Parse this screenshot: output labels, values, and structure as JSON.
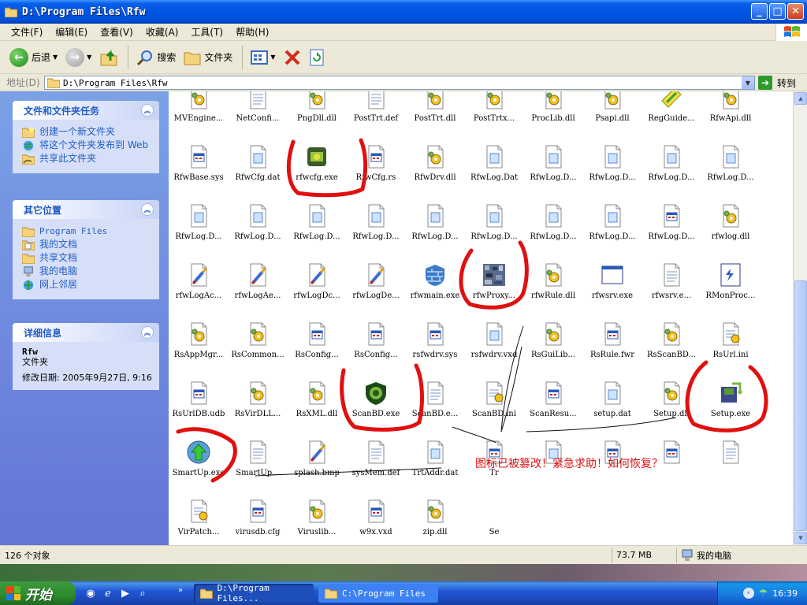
{
  "window": {
    "title": "D:\\Program Files\\Rfw",
    "buttons": {
      "minimize": "_",
      "maximize": "□",
      "close": "✕"
    }
  },
  "menu": [
    "文件(F)",
    "编辑(E)",
    "查看(V)",
    "收藏(A)",
    "工具(T)",
    "帮助(H)"
  ],
  "toolbar": {
    "back": "后退",
    "search": "搜索",
    "folders": "文件夹"
  },
  "address": {
    "label": "地址(D)",
    "value": "D:\\Program Files\\Rfw",
    "go": "转到"
  },
  "sidebar": {
    "tasks": {
      "title": "文件和文件夹任务",
      "items": [
        {
          "label": "创建一个新文件夹",
          "icon": "new-folder-icon"
        },
        {
          "label": "将这个文件夹发布到 Web",
          "icon": "web-publish-icon"
        },
        {
          "label": "共享此文件夹",
          "icon": "share-folder-icon"
        }
      ]
    },
    "places": {
      "title": "其它位置",
      "items": [
        {
          "label": "Program Files",
          "icon": "folder-icon"
        },
        {
          "label": "我的文档",
          "icon": "my-documents-icon"
        },
        {
          "label": "共享文档",
          "icon": "shared-documents-icon"
        },
        {
          "label": "我的电脑",
          "icon": "my-computer-icon"
        },
        {
          "label": "网上邻居",
          "icon": "network-places-icon"
        }
      ]
    },
    "details": {
      "title": "详细信息",
      "name": "Rfw",
      "type": "文件夹",
      "modified": "修改日期: 2005年9月27日, 9:16"
    }
  },
  "files": [
    {
      "name": "MVEngine...",
      "icon": "dll-gear"
    },
    {
      "name": "NetConfi...",
      "icon": "notepad"
    },
    {
      "name": "PngDll.dll",
      "icon": "dll-gear"
    },
    {
      "name": "PostTrt.def",
      "icon": "notepad"
    },
    {
      "name": "PostTrt.dll",
      "icon": "dll-gear"
    },
    {
      "name": "PostTrtx...",
      "icon": "dll-gear"
    },
    {
      "name": "ProcLib.dll",
      "icon": "dll-gear"
    },
    {
      "name": "Psapi.dll",
      "icon": "dll-gear"
    },
    {
      "name": "RegGuide...",
      "icon": "reg-guide"
    },
    {
      "name": "RfwApi.dll",
      "icon": "dll-gear"
    },
    {
      "name": "RfwBase.sys",
      "icon": "sys-file"
    },
    {
      "name": "RfwCfg.dat",
      "icon": "generic-file"
    },
    {
      "name": "rfwcfg.exe",
      "icon": "antivirus-exe"
    },
    {
      "name": "RfwCfg.rs",
      "icon": "sys-file"
    },
    {
      "name": "RfwDrv.dll",
      "icon": "dll-gear"
    },
    {
      "name": "RfwLog.Dat",
      "icon": "generic-file"
    },
    {
      "name": "RfwLog.D...",
      "icon": "generic-file"
    },
    {
      "name": "RfwLog.D...",
      "icon": "generic-file"
    },
    {
      "name": "RfwLog.D...",
      "icon": "generic-file"
    },
    {
      "name": "RfwLog.D...",
      "icon": "generic-file"
    },
    {
      "name": "RfwLog.D...",
      "icon": "generic-file"
    },
    {
      "name": "RfwLog.D...",
      "icon": "generic-file"
    },
    {
      "name": "RfwLog.D...",
      "icon": "generic-file"
    },
    {
      "name": "RfwLog.D...",
      "icon": "generic-file"
    },
    {
      "name": "RfwLog.D...",
      "icon": "generic-file"
    },
    {
      "name": "RfwLog.D...",
      "icon": "generic-file"
    },
    {
      "name": "RfwLog.D...",
      "icon": "generic-file"
    },
    {
      "name": "RfwLog.D...",
      "icon": "generic-file"
    },
    {
      "name": "RfwLog.D...",
      "icon": "sys-file"
    },
    {
      "name": "rfwlog.dll",
      "icon": "dll-gear"
    },
    {
      "name": "rfwLogAc...",
      "icon": "brush-file"
    },
    {
      "name": "rfwLogAe...",
      "icon": "brush-file"
    },
    {
      "name": "rfwLogDc...",
      "icon": "brush-file"
    },
    {
      "name": "rfwLogDe...",
      "icon": "brush-file"
    },
    {
      "name": "rfwmain.exe",
      "icon": "firewall-exe"
    },
    {
      "name": "rfwProxy...",
      "icon": "noise-exe"
    },
    {
      "name": "rfwRule.dll",
      "icon": "dll-gear"
    },
    {
      "name": "rfwsrv.exe",
      "icon": "window-exe"
    },
    {
      "name": "rfwsrv.e...",
      "icon": "notepad"
    },
    {
      "name": "RMonProc...",
      "icon": "monitor-exe"
    },
    {
      "name": "RsAppMgr...",
      "icon": "dll-gear"
    },
    {
      "name": "RsCommon...",
      "icon": "dll-gear"
    },
    {
      "name": "RsConfig...",
      "icon": "sys-file"
    },
    {
      "name": "RsConfig...",
      "icon": "sys-file"
    },
    {
      "name": "rsfwdrv.sys",
      "icon": "sys-file"
    },
    {
      "name": "rsfwdrv.vxd",
      "icon": "generic-file"
    },
    {
      "name": "RsGuiLib...",
      "icon": "dll-gear"
    },
    {
      "name": "RsRule.fwr",
      "icon": "sys-file"
    },
    {
      "name": "RsScanBD...",
      "icon": "dll-gear"
    },
    {
      "name": "RsUrl.ini",
      "icon": "ini-file"
    },
    {
      "name": "RsUrlDB.udb",
      "icon": "sys-file"
    },
    {
      "name": "RsVirDLL...",
      "icon": "dll-gear"
    },
    {
      "name": "RsXML.dll",
      "icon": "dll-gear"
    },
    {
      "name": "ScanBD.exe",
      "icon": "shield-exe"
    },
    {
      "name": "ScanBD.e...",
      "icon": "notepad"
    },
    {
      "name": "ScanBD.ini",
      "icon": "ini-file"
    },
    {
      "name": "ScanResu...",
      "icon": "sys-file"
    },
    {
      "name": "setup.dat",
      "icon": "generic-file"
    },
    {
      "name": "Setup.dll",
      "icon": "dll-gear"
    },
    {
      "name": "Setup.exe",
      "icon": "setup-exe"
    },
    {
      "name": "SmartUp.exe",
      "icon": "smartup-exe"
    },
    {
      "name": "SmartUp...",
      "icon": "notepad"
    },
    {
      "name": "splash.bmp",
      "icon": "brush-file"
    },
    {
      "name": "sysMem.def",
      "icon": "notepad"
    },
    {
      "name": "TrtAddr.dat",
      "icon": "generic-file"
    },
    {
      "name": "Tr",
      "icon": "sys-file"
    },
    {
      "name": "",
      "icon": "generic-file"
    },
    {
      "name": "",
      "icon": "sys-file"
    },
    {
      "name": "",
      "icon": "sys-file"
    },
    {
      "name": "",
      "icon": "notepad"
    },
    {
      "name": "VirPatch...",
      "icon": "ini-file"
    },
    {
      "name": "virusdb.cfg",
      "icon": "sys-file"
    },
    {
      "name": "Viruslib...",
      "icon": "dll-gear"
    },
    {
      "name": "w9x.vxd",
      "icon": "sys-file"
    },
    {
      "name": "zip.dll",
      "icon": "dll-gear"
    },
    {
      "name": "Se",
      "icon": ""
    }
  ],
  "annotation": {
    "text": "图标已被篡改！紧急求助！如何恢复？",
    "color": "#e01010"
  },
  "status": {
    "count": "126 个对象",
    "size": "73.7 MB",
    "location": "我的电脑"
  },
  "taskbar": {
    "start": "开始",
    "buttons": [
      "D:\\Program Files...",
      "C:\\Program Files"
    ],
    "clock": "16:39"
  }
}
